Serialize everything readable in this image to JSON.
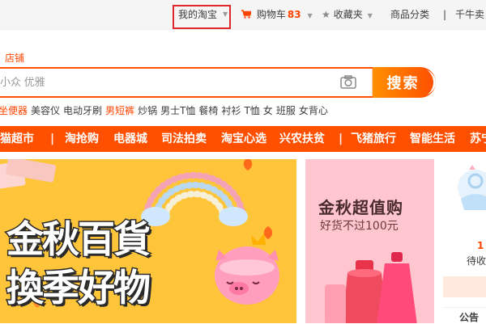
{
  "topbar": {
    "my_taobao": "我的淘宝",
    "cart_label": "购物车",
    "cart_count": "83",
    "favorites": "收藏夹",
    "categories": "商品分类",
    "separator": "|",
    "qianniu": "千牛卖"
  },
  "search": {
    "store_tab": "店铺",
    "placeholder": "小众 优雅",
    "button_label": "搜索"
  },
  "hotwords": [
    {
      "text": "坐便器",
      "hot": true
    },
    {
      "text": "美容仪",
      "hot": false
    },
    {
      "text": "电动牙刷",
      "hot": false
    },
    {
      "text": "男短裤",
      "hot": true
    },
    {
      "text": "炒锅",
      "hot": false
    },
    {
      "text": "男士T恤",
      "hot": false
    },
    {
      "text": "餐椅",
      "hot": false
    },
    {
      "text": "衬衫",
      "hot": false
    },
    {
      "text": "T恤",
      "hot": false
    },
    {
      "text": "女",
      "hot": false
    },
    {
      "text": "班服",
      "hot": false
    },
    {
      "text": "女背心",
      "hot": false
    }
  ],
  "category_nav": [
    "猫超市",
    "|",
    "淘抢购",
    "电器城",
    "司法拍卖",
    "淘宝心选",
    "兴农扶贫",
    "|",
    "飞猪旅行",
    "智能生活",
    "苏宁"
  ],
  "banner": {
    "line1": "金秋百貨",
    "line2": "換季好物"
  },
  "promo": {
    "title": "金秋超值购",
    "subtitle": "好货不过100元"
  },
  "user_panel": {
    "count": "1",
    "pending_label": "待收",
    "notice": "公告"
  },
  "colors": {
    "brand_orange": "#ff5000",
    "highlight_red": "#e0282c",
    "banner_yellow": "#ffc53a",
    "promo_pink": "#ffc6cf"
  }
}
